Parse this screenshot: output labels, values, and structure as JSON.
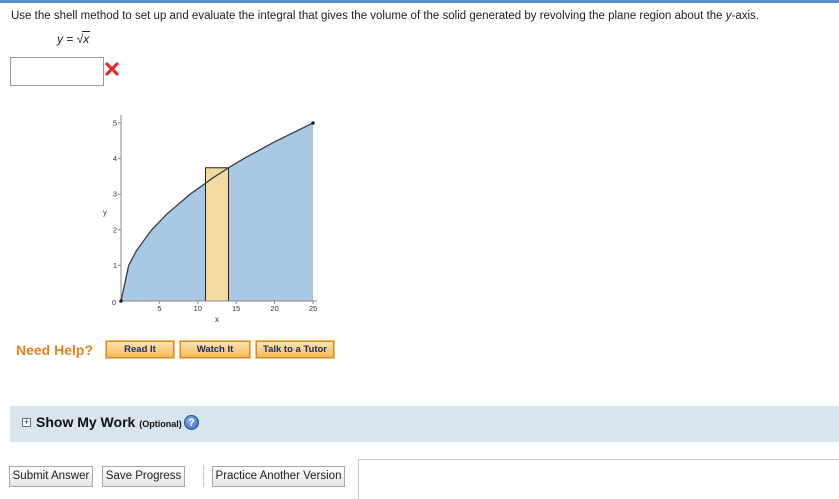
{
  "question": {
    "text_before": "Use the shell method to set up and evaluate the integral that gives the volume of the solid generated by revolving the plane region about the ",
    "axis_name": "y",
    "text_after": "-axis."
  },
  "equation": {
    "lhs": "y",
    "equals": "=",
    "radicand": "x"
  },
  "answer_input": {
    "value": "",
    "placeholder": ""
  },
  "answer_status": {
    "icon": "red-x-icon",
    "color": "#e0302b"
  },
  "chart_data": {
    "type": "area",
    "function": "y = sqrt(x)",
    "x": [
      0,
      1,
      2,
      4,
      6,
      9,
      12,
      14,
      16,
      20,
      25
    ],
    "y": [
      0,
      1,
      1.414,
      2,
      2.449,
      3,
      3.464,
      3.742,
      4,
      4.472,
      5
    ],
    "xlim": [
      0,
      25
    ],
    "ylim": [
      0,
      5
    ],
    "xticks": [
      "5",
      "10",
      "15",
      "20",
      "25"
    ],
    "yticks": [
      "1",
      "2",
      "3",
      "4",
      "5"
    ],
    "origin_label": "0",
    "xlabel": "x",
    "ylabel": "y",
    "shell_rectangle": {
      "x_start": 11,
      "x_end": 14,
      "height": 3.742
    },
    "region_color": "#a8c8e6",
    "shell_color": "#f3d9a2",
    "curve_color": "#3d3d3d"
  },
  "help": {
    "label": "Need Help?",
    "buttons": [
      "Read It",
      "Watch It",
      "Talk to a Tutor"
    ]
  },
  "show_my_work": {
    "title": "Show My Work",
    "optional": "(Optional)",
    "expand_icon": "plus-box-icon",
    "help_icon": "question-mark-icon",
    "help_glyph": "?"
  },
  "actions": {
    "submit": "Submit Answer",
    "save": "Save Progress",
    "practice": "Practice Another Version"
  }
}
